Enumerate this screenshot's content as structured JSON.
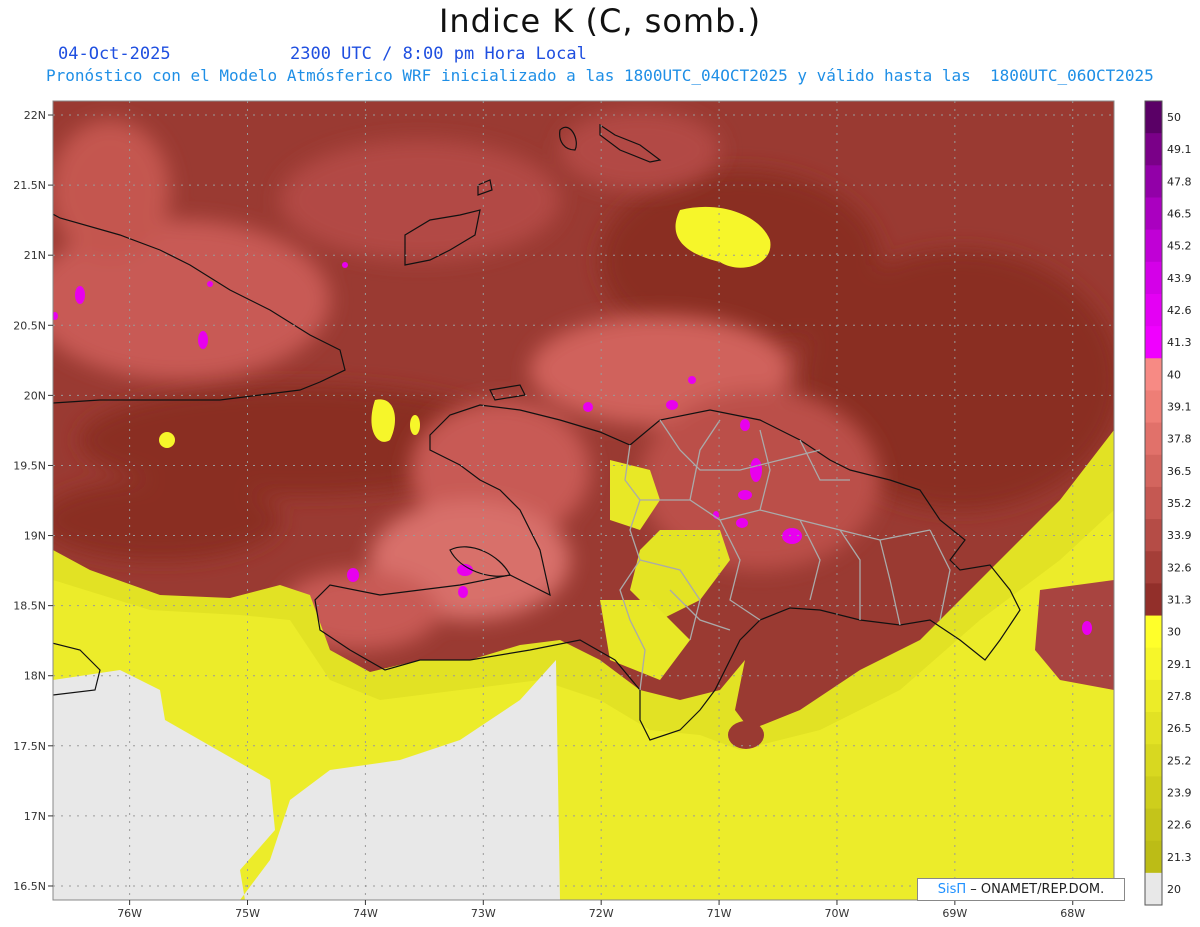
{
  "header": {
    "title": "Indice K (C, somb.)",
    "date": "04-Oct-2025",
    "time": "2300 UTC / 8:00 pm Hora Local",
    "subtitle": "Pronóstico con el Modelo Atmósferico WRF inicializado a las 1800UTC_04OCT2025 y válido hasta las  1800UTC_06OCT2025"
  },
  "map": {
    "lat_labels": [
      "22N",
      "21.5N",
      "21N",
      "20.5N",
      "20N",
      "19.5N",
      "19N",
      "18.5N",
      "18N",
      "17.5N",
      "17N",
      "16.5N"
    ],
    "lon_labels": [
      "76W",
      "75W",
      "74W",
      "73W",
      "72W",
      "71W",
      "70W",
      "69W",
      "68W"
    ],
    "lat_range": [
      16.4,
      22.1
    ],
    "lon_range": [
      -76.65,
      -67.65
    ]
  },
  "colorbar": {
    "labels": [
      "50",
      "49.1",
      "47.8",
      "46.5",
      "45.2",
      "43.9",
      "42.6",
      "41.3",
      "40",
      "39.1",
      "37.8",
      "36.5",
      "35.2",
      "33.9",
      "32.6",
      "31.3",
      "30",
      "29.1",
      "27.8",
      "26.5",
      "25.2",
      "23.9",
      "22.6",
      "21.3",
      "20"
    ],
    "colors": [
      "#5a0066",
      "#7a0088",
      "#9200a8",
      "#aa00c0",
      "#c000d6",
      "#d400e8",
      "#e400f4",
      "#f000ff",
      "#f78a84",
      "#ee7e76",
      "#e1716a",
      "#d3655e",
      "#c55852",
      "#b54c46",
      "#a43e38",
      "#922f2a",
      "#ffff2a",
      "#f6f62a",
      "#ecec28",
      "#e2e224",
      "#d8d820",
      "#cece1c",
      "#c4c41a",
      "#bcbc16",
      "#e8e8e8"
    ]
  },
  "colors": {
    "warm_field": "#9a3a32",
    "hot_field": "#d0625c",
    "very_hot": "#ec8078",
    "cool_field": "#e4e420",
    "land_gray": "#e8e8e8"
  },
  "credit": {
    "brand": "SisΠ",
    "text": " – ONAMET/REP.DOM."
  }
}
